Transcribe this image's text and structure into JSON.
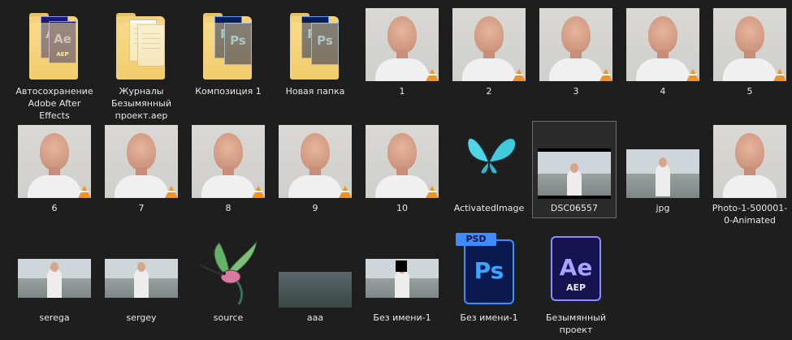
{
  "files": [
    {
      "label": "Автосохранение Adobe After Effects",
      "icon": "folder-ae-icon"
    },
    {
      "label": "Журналы Безымянный проект.aep",
      "icon": "folder-documents-icon"
    },
    {
      "label": "Композиция 1",
      "icon": "folder-ps-icon"
    },
    {
      "label": "Новая папка",
      "icon": "folder-ps-icon"
    },
    {
      "label": "1",
      "icon": "portrait-video-thumbnail"
    },
    {
      "label": "2",
      "icon": "portrait-video-thumbnail"
    },
    {
      "label": "3",
      "icon": "portrait-video-thumbnail"
    },
    {
      "label": "4",
      "icon": "portrait-video-thumbnail"
    },
    {
      "label": "5",
      "icon": "portrait-video-thumbnail"
    },
    {
      "label": "6",
      "icon": "portrait-video-thumbnail"
    },
    {
      "label": "7",
      "icon": "portrait-video-thumbnail"
    },
    {
      "label": "8",
      "icon": "portrait-video-thumbnail"
    },
    {
      "label": "9",
      "icon": "portrait-video-thumbnail"
    },
    {
      "label": "10",
      "icon": "portrait-video-thumbnail"
    },
    {
      "label": "ActivatedImage",
      "icon": "butterfly-image-thumbnail"
    },
    {
      "label": "DSC06557",
      "icon": "landscape-image-thumbnail"
    },
    {
      "label": "jpg",
      "icon": "landscape-image-thumbnail"
    },
    {
      "label": "Photo-1-500001-0-Animated",
      "icon": "portrait-image-thumbnail"
    },
    {
      "label": "serega",
      "icon": "landscape-image-thumbnail"
    },
    {
      "label": "sergey",
      "icon": "landscape-image-thumbnail"
    },
    {
      "label": "source",
      "icon": "hummingbird-image-thumbnail"
    },
    {
      "label": "aaa",
      "icon": "landscape-image-thumbnail"
    },
    {
      "label": "Без имени-1",
      "icon": "landscape-image-thumbnail"
    },
    {
      "label": "Без имени-1",
      "icon": "psd-file-icon"
    },
    {
      "label": "Безымянный проект",
      "icon": "aep-file-icon"
    }
  ],
  "app_icons": {
    "ae_glyph": "Ae",
    "ae_ext": "AEP",
    "ps_glyph": "Ps",
    "psd_badge": "PSD"
  },
  "colors": {
    "background": "#1e1e1e",
    "folder": "#f3d27a",
    "vlc_cone": "#f39221",
    "ps_blue": "#39a5ff",
    "ae_purple": "#a6a3ff"
  }
}
